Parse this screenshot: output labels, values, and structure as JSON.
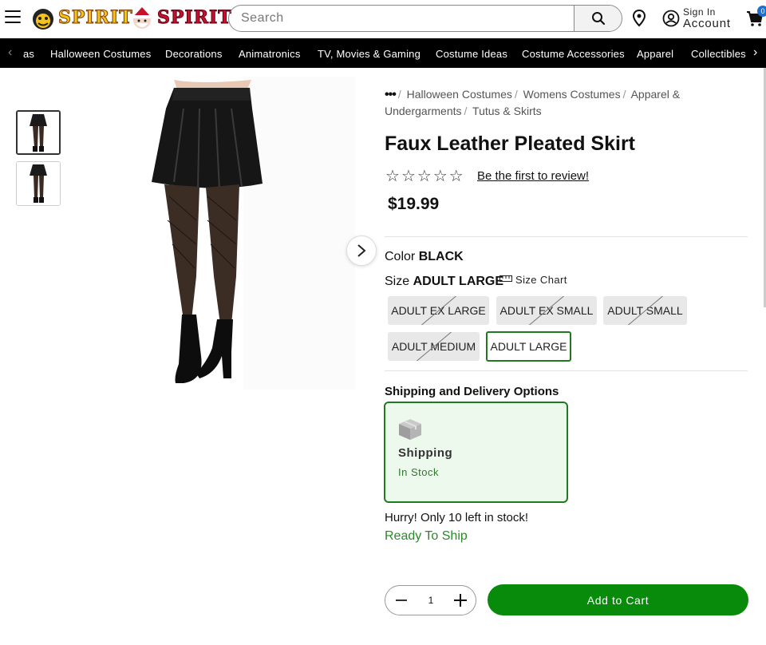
{
  "header": {
    "logo1_text": "SPIRIT",
    "logo2_text": "SPIRIT",
    "search_placeholder": "Search",
    "signin_label": "Sign In",
    "account_label": "Account",
    "cart_count": "0",
    "brand_yellow": "#f6c31a",
    "brand_red": "#c8102e"
  },
  "nav": {
    "prev_partial": "as",
    "items": [
      "Halloween Costumes",
      "Decorations",
      "Animatronics",
      "TV, Movies & Gaming",
      "Costume Ideas",
      "Costume Accessories",
      "Apparel",
      "Collectibles"
    ]
  },
  "breadcrumb": {
    "items": [
      "Halloween Costumes",
      "Womens Costumes",
      "Apparel & Undergarments",
      "Tutus & Skirts"
    ]
  },
  "product": {
    "title": "Faux Leather Pleated Skirt",
    "rating_stars": 0,
    "review_link": "Be the first to review!",
    "price": "$19.99",
    "color_label": "Color",
    "color_value": "BLACK",
    "size_label": "Size",
    "size_value": "ADULT LARGE",
    "size_chart_label": "Size Chart",
    "sizes": [
      {
        "label": "ADULT EX LARGE",
        "available": false
      },
      {
        "label": "ADULT EX SMALL",
        "available": false
      },
      {
        "label": "ADULT SMALL",
        "available": false
      },
      {
        "label": "ADULT MEDIUM",
        "available": false
      },
      {
        "label": "ADULT LARGE",
        "available": true,
        "selected": true
      }
    ]
  },
  "shipping": {
    "section_title": "Shipping and Delivery Options",
    "option_label": "Shipping",
    "option_status": "In Stock",
    "stock_note": "Hurry! Only 10 left in stock!",
    "ready_note": "Ready To Ship",
    "accent": "#1d7c1d"
  },
  "purchase": {
    "quantity": "1",
    "add_to_cart_label": "Add to Cart",
    "button_color": "#088a0a"
  }
}
